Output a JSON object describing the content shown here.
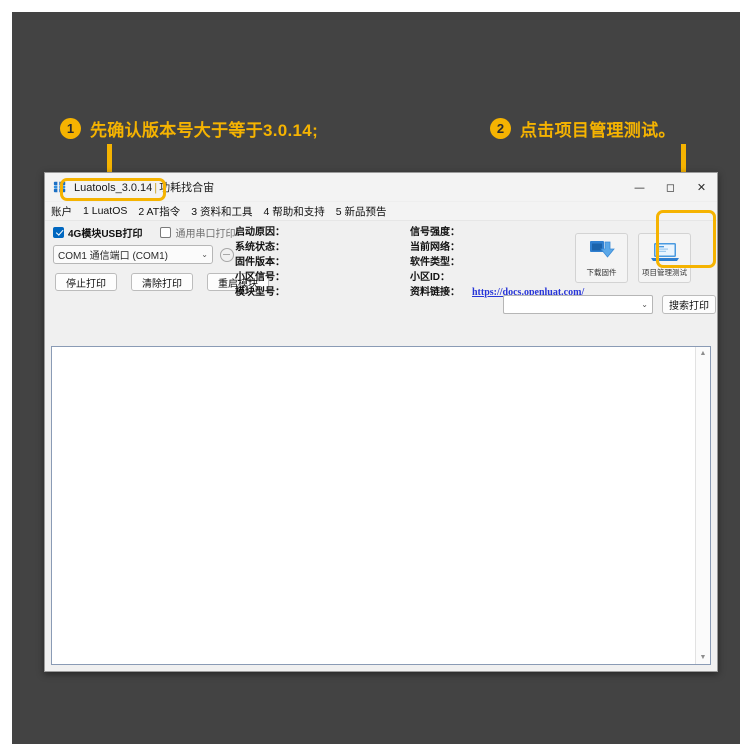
{
  "annotations": [
    {
      "number": "1",
      "text": "先确认版本号大于等于3.0.14;"
    },
    {
      "number": "2",
      "text": "点击项目管理测试。"
    }
  ],
  "window": {
    "title_app": "Luatools_3.0.14",
    "title_sep": "|",
    "title_suffix": "功耗找合宙",
    "controls": {
      "minimize": "—",
      "maximize": "◻",
      "close": "✕"
    },
    "menu": [
      "账户",
      "1 LuatOS",
      "2 AT指令",
      "3 资料和工具",
      "4 帮助和支持",
      "5 新品预告"
    ],
    "checkboxes": [
      {
        "label": "4G模块USB打印",
        "checked": true
      },
      {
        "label": "通用串口打印",
        "checked": false
      }
    ],
    "port_combo": {
      "value": "COM1 通信端口 (COM1)",
      "chevron": "⌄"
    },
    "refresh_icon": "refresh-icon",
    "action_buttons": [
      "停止打印",
      "清除打印",
      "重启模块"
    ],
    "info_middle": [
      "启动原因：",
      "系统状态：",
      "固件版本：",
      "小区信号：",
      "模块型号："
    ],
    "info_right": [
      {
        "label": "信号强度：",
        "value": ""
      },
      {
        "label": "当前网络：",
        "value": ""
      },
      {
        "label": "软件类型：",
        "value": ""
      },
      {
        "label": "小区ID：",
        "value": ""
      },
      {
        "label": "资料链接：",
        "value": "https://docs.openluat.com/"
      }
    ],
    "big_buttons": [
      {
        "caption": "下载固件",
        "icon": "download-firmware-icon"
      },
      {
        "caption": "项目管理测试",
        "icon": "laptop-project-icon"
      }
    ],
    "search": {
      "input_value": "",
      "input_placeholder": "",
      "chevron": "⌄",
      "button_label": "搜索打印"
    },
    "log": {
      "content": ""
    },
    "scrollbar": {
      "up": "▲",
      "down": "▼"
    }
  },
  "colors": {
    "backdrop": "#434343",
    "accent": "#f5b301",
    "link": "#2735d8",
    "checkbox_checked": "#0067c0"
  }
}
